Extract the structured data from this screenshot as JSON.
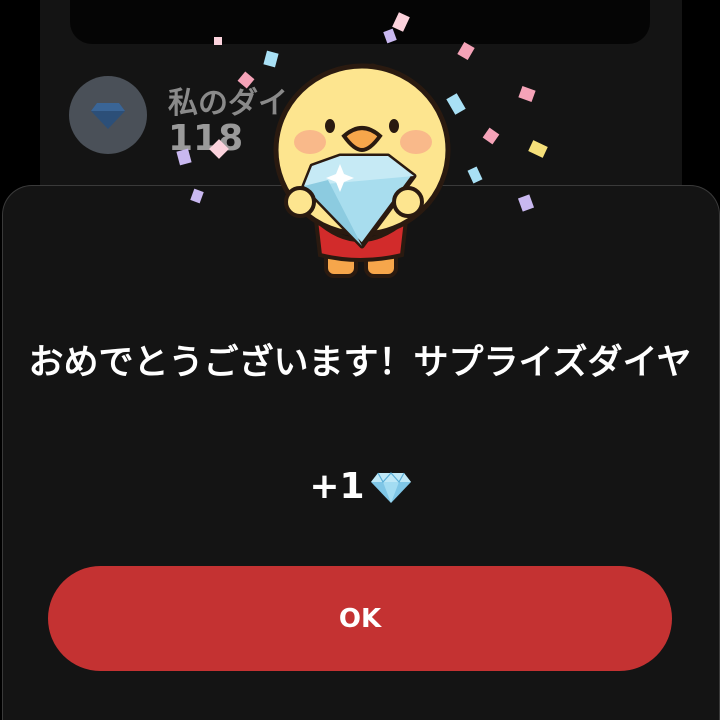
{
  "background": {
    "diamond_label": "私のダイ",
    "diamond_count": "118"
  },
  "dialog": {
    "title": "おめでとうございます！サプライズダイヤ",
    "reward_amount": "+1",
    "reward_icon": "diamond-icon",
    "ok_label": "OK"
  },
  "colors": {
    "sheet_background": "#141414",
    "ok_button": "#c43232",
    "diamond": "#a8ddee",
    "mascot_body": "#fde58f"
  }
}
